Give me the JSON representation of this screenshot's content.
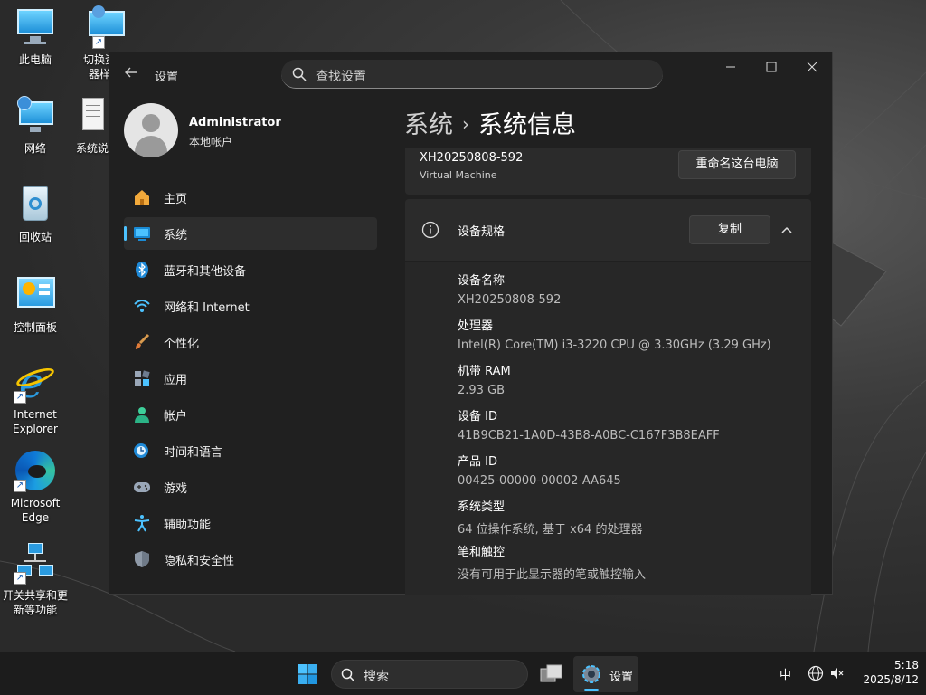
{
  "desktop": {
    "icons": [
      {
        "label": "此电脑",
        "icon": "computer-icon"
      },
      {
        "label": "切换资源管理器样式",
        "label_visible": "切换资源\n器样式",
        "icon": "computer-shortcut-icon"
      },
      {
        "label": "网络",
        "icon": "network-icon"
      },
      {
        "label": "系统说明",
        "label_visible": "系统说",
        "icon": "document-icon"
      },
      {
        "label": "回收站",
        "icon": "recycle-bin-icon"
      },
      {
        "label": "控制面板",
        "icon": "control-panel-icon"
      },
      {
        "label": "Internet Explorer",
        "icon": "internet-explorer-icon"
      },
      {
        "label": "Microsoft Edge",
        "icon": "edge-icon"
      },
      {
        "label": "开关共享和更新等功能",
        "icon": "network-share-icon"
      }
    ],
    "icon_labels": {
      "this_pc": "此电脑",
      "switch_l1": "切换资源",
      "switch_l2": "器样式",
      "network": "网络",
      "readme": "系统说",
      "recycle": "回收站",
      "control_panel": "控制面板",
      "ie_l1": "Internet",
      "ie_l2": "Explorer",
      "edge_l1": "Microsoft",
      "edge_l2": "Edge",
      "share_l1": "开关共享和更",
      "share_l2": "新等功能"
    }
  },
  "window": {
    "title": "设置",
    "search_placeholder": "查找设置",
    "controls": {
      "minimize": "—",
      "maximize": "☐",
      "close": "✕"
    }
  },
  "profile": {
    "name": "Administrator",
    "account_type": "本地帐户"
  },
  "sidebar": {
    "items": [
      {
        "label": "主页",
        "icon": "home-icon"
      },
      {
        "label": "系统",
        "icon": "system-icon",
        "active": true
      },
      {
        "label": "蓝牙和其他设备",
        "icon": "bluetooth-icon"
      },
      {
        "label": "网络和 Internet",
        "icon": "wifi-icon"
      },
      {
        "label": "个性化",
        "icon": "brush-icon"
      },
      {
        "label": "应用",
        "icon": "apps-icon"
      },
      {
        "label": "帐户",
        "icon": "account-icon"
      },
      {
        "label": "时间和语言",
        "icon": "time-language-icon"
      },
      {
        "label": "游戏",
        "icon": "gamepad-icon"
      },
      {
        "label": "辅助功能",
        "icon": "accessibility-icon"
      },
      {
        "label": "隐私和安全性",
        "icon": "shield-icon"
      }
    ]
  },
  "breadcrumb": {
    "parent": "系统",
    "separator": "›",
    "current": "系统信息"
  },
  "device_card": {
    "device_name": "XH20250808-592",
    "model": "Virtual Machine",
    "rename_button": "重命名这台电脑"
  },
  "specs": {
    "title": "设备规格",
    "copy_button": "复制",
    "rows": [
      {
        "key": "设备名称",
        "value": "XH20250808-592"
      },
      {
        "key": "处理器",
        "value": "Intel(R) Core(TM) i3-3220 CPU @ 3.30GHz (3.29 GHz)"
      },
      {
        "key": "机带 RAM",
        "value": "2.93 GB"
      },
      {
        "key": "设备 ID",
        "value": "41B9CB21-1A0D-43B8-A0BC-C167F3B8EAFF"
      },
      {
        "key": "产品 ID",
        "value": "00425-00000-00002-AA645"
      },
      {
        "key": "系统类型",
        "value": "64 位操作系统, 基于 x64 的处理器"
      },
      {
        "key": "笔和触控",
        "value": "没有可用于此显示器的笔或触控输入"
      }
    ]
  },
  "taskbar": {
    "search_label": "搜索",
    "pinned_app_label": "设置",
    "ime": "中",
    "time": "5:18",
    "date": "2025/8/12"
  },
  "colors": {
    "accent": "#4cc2ff",
    "window_bg": "#202020",
    "card_bg": "#2b2b2b"
  }
}
